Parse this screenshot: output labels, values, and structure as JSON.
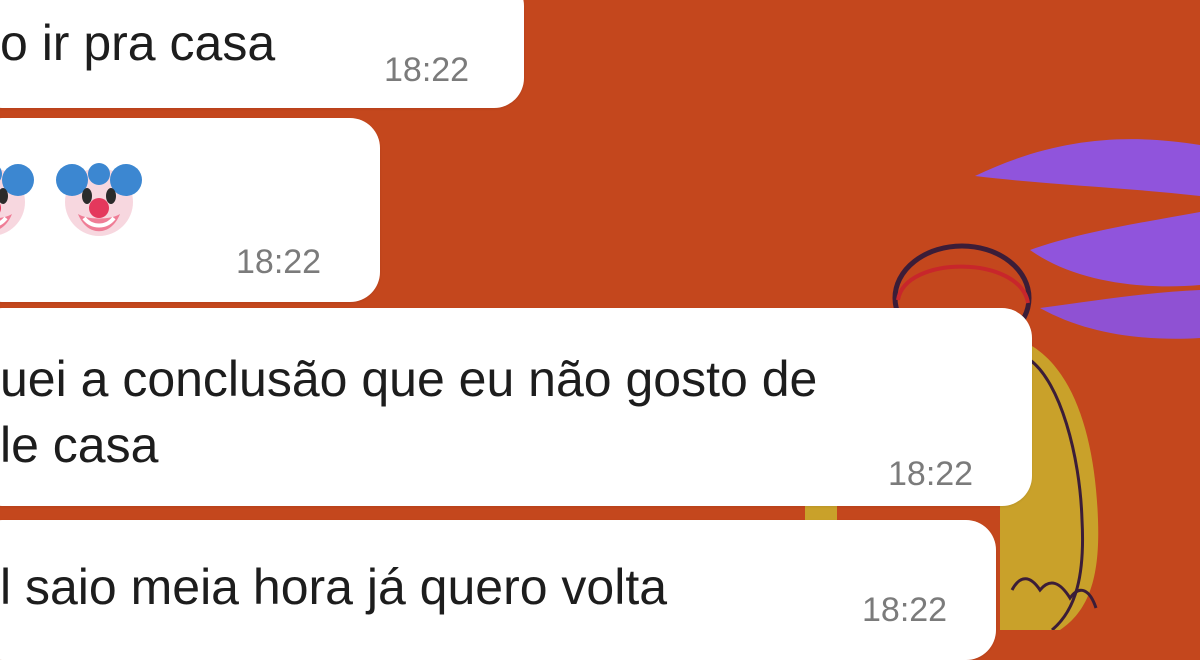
{
  "theme": {
    "background": "#c4471d",
    "bubble": "#ffffff",
    "text": "#1d1d1d",
    "timestamp": "#7b7b7b",
    "accent_purple": "#8d55e7",
    "accent_yellow": "#c9a12a"
  },
  "conversation": {
    "messages": [
      {
        "text": "o ir pra casa",
        "time": "18:22"
      },
      {
        "icon_name": "clown-face-emoji",
        "time": "18:22"
      },
      {
        "line1": "uei a conclusão que eu não gosto de",
        "line2": "le casa",
        "time": "18:22"
      },
      {
        "text": "l saio meia hora já quero volta",
        "time": "18:22"
      }
    ]
  }
}
